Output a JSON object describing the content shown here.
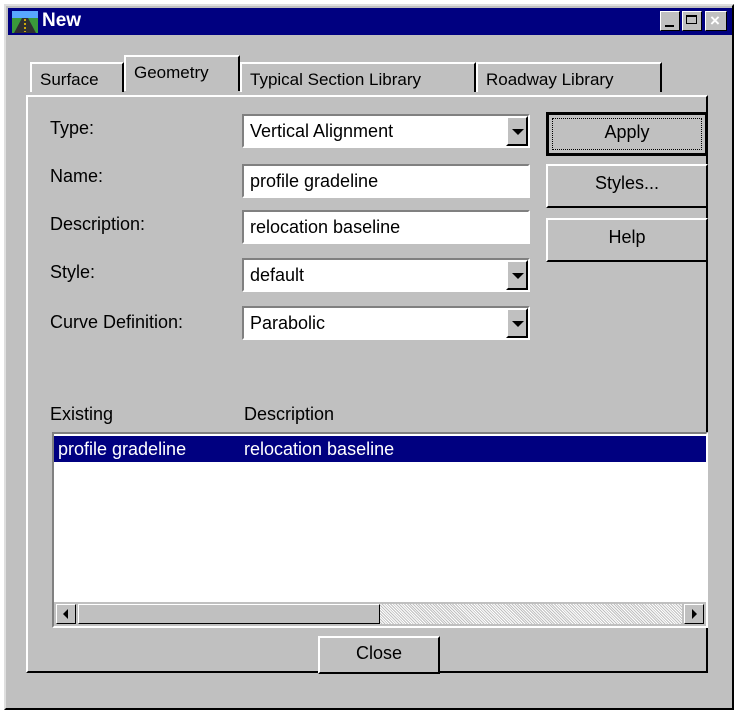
{
  "window": {
    "title": "New"
  },
  "tabs": [
    {
      "label": "Surface",
      "active": false
    },
    {
      "label": "Geometry",
      "active": true
    },
    {
      "label": "Typical Section Library",
      "active": false
    },
    {
      "label": "Roadway Library",
      "active": false
    }
  ],
  "form": {
    "type_label": "Type:",
    "type_value": "Vertical Alignment",
    "name_label": "Name:",
    "name_value": "profile gradeline",
    "description_label": "Description:",
    "description_value": "relocation baseline",
    "style_label": "Style:",
    "style_value": "default",
    "curve_label": "Curve Definition:",
    "curve_value": "Parabolic"
  },
  "buttons": {
    "apply": "Apply",
    "styles": "Styles...",
    "help": "Help",
    "close": "Close"
  },
  "list": {
    "col_existing": "Existing",
    "col_description": "Description",
    "rows": [
      {
        "existing": "profile gradeline",
        "description": "relocation baseline",
        "selected": true
      }
    ]
  },
  "colors": {
    "title_bar": "#000080",
    "face": "#c0c0c0",
    "selection": "#000080"
  }
}
